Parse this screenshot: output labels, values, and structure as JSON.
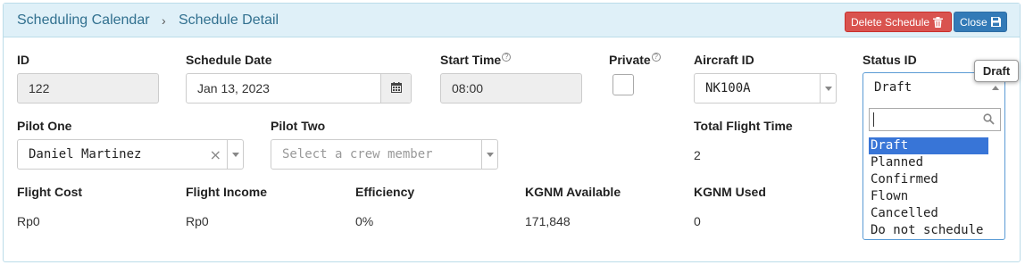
{
  "breadcrumb": {
    "parent": "Scheduling Calendar",
    "separator": "›",
    "current": "Schedule Detail"
  },
  "actions": {
    "delete_label": "Delete Schedule",
    "close_label": "Close"
  },
  "form": {
    "id": {
      "label": "ID",
      "value": "122"
    },
    "schedule_date": {
      "label": "Schedule Date",
      "value": "Jan 13, 2023"
    },
    "start_time": {
      "label": "Start Time",
      "value": "08:00"
    },
    "private": {
      "label": "Private",
      "checked": false
    },
    "aircraft_id": {
      "label": "Aircraft ID",
      "value": "NK100A"
    },
    "status_id": {
      "label": "Status ID",
      "value": "Draft",
      "search_value": "",
      "options": [
        "Draft",
        "Planned",
        "Confirmed",
        "Flown",
        "Cancelled",
        "Do not schedule"
      ],
      "highlighted": "Draft"
    },
    "pilot_one": {
      "label": "Pilot One",
      "value": "Daniel Martinez",
      "clear": "×"
    },
    "pilot_two": {
      "label": "Pilot Two",
      "placeholder": "Select a crew member"
    },
    "total_flight_time": {
      "label": "Total Flight Time",
      "value": "2"
    },
    "flight_cost": {
      "label": "Flight Cost",
      "value": "Rp0"
    },
    "flight_income": {
      "label": "Flight Income",
      "value": "Rp0"
    },
    "efficiency": {
      "label": "Efficiency",
      "value": "0%"
    },
    "kgnm_available": {
      "label": "KGNM Available",
      "value": "171,848"
    },
    "kgnm_used": {
      "label": "KGNM Used",
      "value": "0"
    }
  },
  "tooltip": {
    "text": "Draft"
  },
  "help_glyph": "?",
  "icons": {
    "delete": "trash-icon",
    "close": "save-icon",
    "calendar": "calendar-icon",
    "search": "search-icon"
  },
  "colors": {
    "header_bg": "#dff0f8",
    "header_text": "#31708f",
    "danger": "#d9534f",
    "primary": "#337ab7",
    "highlight": "#3875d7"
  }
}
